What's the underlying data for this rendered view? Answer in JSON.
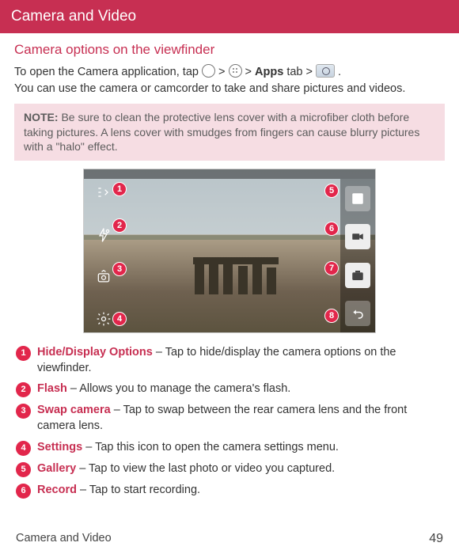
{
  "header": {
    "title": "Camera and Video"
  },
  "section": {
    "subtitle": "Camera options on the viewfinder",
    "intro1_a": "To open the Camera application, tap ",
    "intro1_b": " > ",
    "intro1_c": " > ",
    "intro1_apps": "Apps",
    "intro1_d": " tab > ",
    "intro1_e": " .",
    "intro2": "You can use the camera or camcorder to take and share pictures and videos."
  },
  "note": {
    "label": "NOTE:",
    "text": " Be sure to clean the protective lens cover with a microfiber cloth before taking pictures. A lens cover with smudges from fingers can cause blurry pictures with a \"halo\" effect."
  },
  "badges": {
    "b1": "1",
    "b2": "2",
    "b3": "3",
    "b4": "4",
    "b5": "5",
    "b6": "6",
    "b7": "7",
    "b8": "8"
  },
  "items": [
    {
      "num": "1",
      "term": "Hide/Display Options",
      "desc": " – Tap to hide/display the camera options on the viewfinder."
    },
    {
      "num": "2",
      "term": "Flash",
      "desc": " – Allows you to manage the camera's flash."
    },
    {
      "num": "3",
      "term": "Swap camera",
      "desc": " – Tap to swap between the rear camera lens and the front camera lens."
    },
    {
      "num": "4",
      "term": "Settings",
      "desc": " – Tap this icon to open the camera settings menu."
    },
    {
      "num": "5",
      "term": "Gallery",
      "desc": " – Tap to view the last photo or video you captured."
    },
    {
      "num": "6",
      "term": "Record",
      "desc": " – Tap to start recording."
    }
  ],
  "footer": {
    "left": "Camera and Video",
    "page": "49"
  }
}
